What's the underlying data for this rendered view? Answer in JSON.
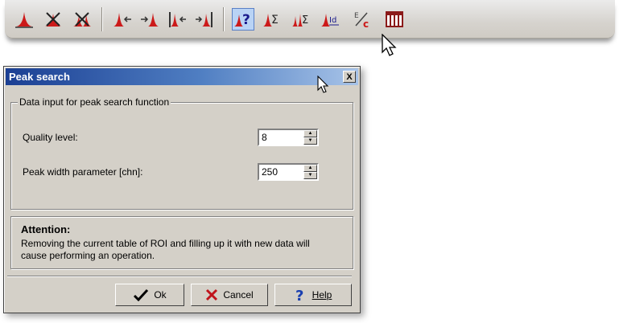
{
  "toolbar": {
    "buttons": [
      {
        "icon": "peak-icon"
      },
      {
        "icon": "remove-peak-icon"
      },
      {
        "icon": "remove-all-peaks-icon"
      },
      {
        "icon": "roi-left-icon"
      },
      {
        "icon": "roi-right-icon"
      },
      {
        "icon": "roi-left-bar-icon"
      },
      {
        "icon": "roi-right-bar-icon"
      },
      {
        "icon": "peak-search-icon"
      },
      {
        "icon": "peak-sum-icon"
      },
      {
        "icon": "peak-sum-all-icon"
      },
      {
        "icon": "peak-identify-icon"
      },
      {
        "icon": "energy-calibration-icon"
      },
      {
        "icon": "columns-icon"
      }
    ],
    "icon_texts": {
      "sigma": "Σ",
      "id": "Id",
      "energy_e": "E",
      "energy_c": "c"
    }
  },
  "dialog": {
    "title": "Peak search",
    "close": "X",
    "group_label": "Data input for peak search function",
    "quality_label": "Quality level:",
    "quality_value": "8",
    "width_label": "Peak width parameter [chn]:",
    "width_value": "250",
    "attention_title": "Attention:",
    "attention_text": "Removing the current table of ROI and filling up it with new data will cause performing an operation.",
    "ok_label": "Ok",
    "cancel_label": "Cancel",
    "help_label": "Help"
  },
  "colors": {
    "peak_red": "#cc1a1a",
    "accent_blue": "#1b3f93",
    "dialog_bg": "#d4d0c8"
  }
}
